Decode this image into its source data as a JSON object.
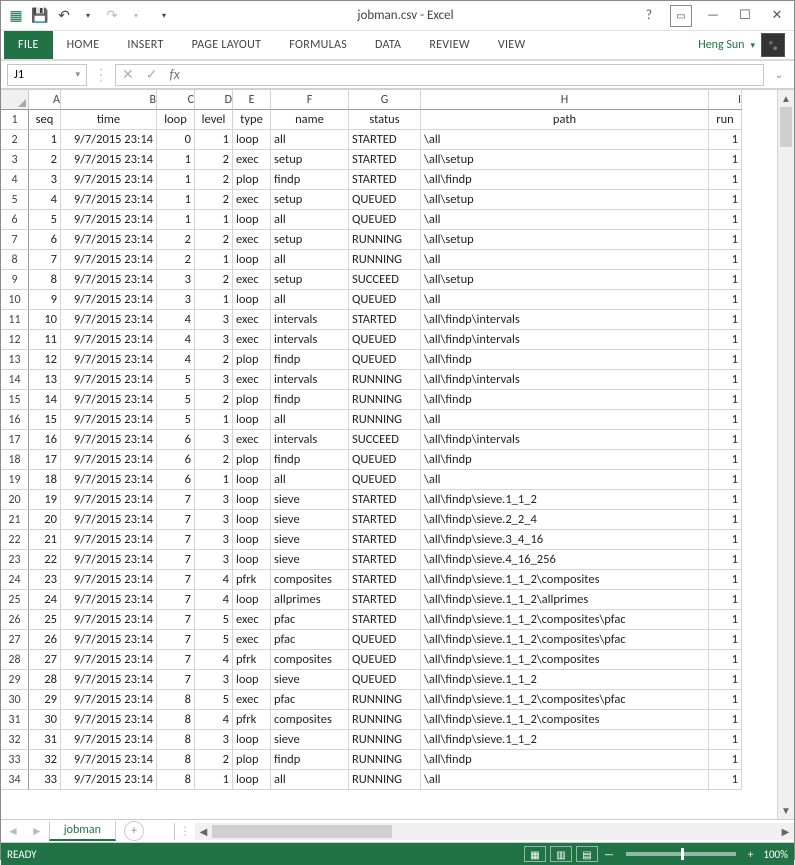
{
  "title": "jobman.csv - Excel",
  "user": "Heng Sun",
  "ribbon_tabs": [
    "FILE",
    "HOME",
    "INSERT",
    "PAGE LAYOUT",
    "FORMULAS",
    "DATA",
    "REVIEW",
    "VIEW"
  ],
  "namebox": "J1",
  "sheet_name": "jobman",
  "status": "READY",
  "zoom": "100%",
  "columns": [
    "A",
    "B",
    "C",
    "D",
    "E",
    "F",
    "G",
    "H",
    "I"
  ],
  "headers": {
    "A": "seq",
    "B": "time",
    "C": "loop",
    "D": "level",
    "E": "type",
    "F": "name",
    "G": "status",
    "H": "path",
    "I": "run"
  },
  "rows": [
    {
      "r": 2,
      "A": "1",
      "B": "9/7/2015 23:14",
      "C": "0",
      "D": "1",
      "E": "loop",
      "F": "all",
      "G": "STARTED",
      "H": "\\all",
      "I": "1"
    },
    {
      "r": 3,
      "A": "2",
      "B": "9/7/2015 23:14",
      "C": "1",
      "D": "2",
      "E": "exec",
      "F": "setup",
      "G": "STARTED",
      "H": "\\all\\setup",
      "I": "1"
    },
    {
      "r": 4,
      "A": "3",
      "B": "9/7/2015 23:14",
      "C": "1",
      "D": "2",
      "E": "plop",
      "F": "findp",
      "G": "STARTED",
      "H": "\\all\\findp",
      "I": "1"
    },
    {
      "r": 5,
      "A": "4",
      "B": "9/7/2015 23:14",
      "C": "1",
      "D": "2",
      "E": "exec",
      "F": "setup",
      "G": "QUEUED",
      "H": "\\all\\setup",
      "I": "1"
    },
    {
      "r": 6,
      "A": "5",
      "B": "9/7/2015 23:14",
      "C": "1",
      "D": "1",
      "E": "loop",
      "F": "all",
      "G": "QUEUED",
      "H": "\\all",
      "I": "1"
    },
    {
      "r": 7,
      "A": "6",
      "B": "9/7/2015 23:14",
      "C": "2",
      "D": "2",
      "E": "exec",
      "F": "setup",
      "G": "RUNNING",
      "H": "\\all\\setup",
      "I": "1"
    },
    {
      "r": 8,
      "A": "7",
      "B": "9/7/2015 23:14",
      "C": "2",
      "D": "1",
      "E": "loop",
      "F": "all",
      "G": "RUNNING",
      "H": "\\all",
      "I": "1"
    },
    {
      "r": 9,
      "A": "8",
      "B": "9/7/2015 23:14",
      "C": "3",
      "D": "2",
      "E": "exec",
      "F": "setup",
      "G": "SUCCEED",
      "H": "\\all\\setup",
      "I": "1"
    },
    {
      "r": 10,
      "A": "9",
      "B": "9/7/2015 23:14",
      "C": "3",
      "D": "1",
      "E": "loop",
      "F": "all",
      "G": "QUEUED",
      "H": "\\all",
      "I": "1"
    },
    {
      "r": 11,
      "A": "10",
      "B": "9/7/2015 23:14",
      "C": "4",
      "D": "3",
      "E": "exec",
      "F": "intervals",
      "G": "STARTED",
      "H": "\\all\\findp\\intervals",
      "I": "1"
    },
    {
      "r": 12,
      "A": "11",
      "B": "9/7/2015 23:14",
      "C": "4",
      "D": "3",
      "E": "exec",
      "F": "intervals",
      "G": "QUEUED",
      "H": "\\all\\findp\\intervals",
      "I": "1"
    },
    {
      "r": 13,
      "A": "12",
      "B": "9/7/2015 23:14",
      "C": "4",
      "D": "2",
      "E": "plop",
      "F": "findp",
      "G": "QUEUED",
      "H": "\\all\\findp",
      "I": "1"
    },
    {
      "r": 14,
      "A": "13",
      "B": "9/7/2015 23:14",
      "C": "5",
      "D": "3",
      "E": "exec",
      "F": "intervals",
      "G": "RUNNING",
      "H": "\\all\\findp\\intervals",
      "I": "1"
    },
    {
      "r": 15,
      "A": "14",
      "B": "9/7/2015 23:14",
      "C": "5",
      "D": "2",
      "E": "plop",
      "F": "findp",
      "G": "RUNNING",
      "H": "\\all\\findp",
      "I": "1"
    },
    {
      "r": 16,
      "A": "15",
      "B": "9/7/2015 23:14",
      "C": "5",
      "D": "1",
      "E": "loop",
      "F": "all",
      "G": "RUNNING",
      "H": "\\all",
      "I": "1"
    },
    {
      "r": 17,
      "A": "16",
      "B": "9/7/2015 23:14",
      "C": "6",
      "D": "3",
      "E": "exec",
      "F": "intervals",
      "G": "SUCCEED",
      "H": "\\all\\findp\\intervals",
      "I": "1"
    },
    {
      "r": 18,
      "A": "17",
      "B": "9/7/2015 23:14",
      "C": "6",
      "D": "2",
      "E": "plop",
      "F": "findp",
      "G": "QUEUED",
      "H": "\\all\\findp",
      "I": "1"
    },
    {
      "r": 19,
      "A": "18",
      "B": "9/7/2015 23:14",
      "C": "6",
      "D": "1",
      "E": "loop",
      "F": "all",
      "G": "QUEUED",
      "H": "\\all",
      "I": "1"
    },
    {
      "r": 20,
      "A": "19",
      "B": "9/7/2015 23:14",
      "C": "7",
      "D": "3",
      "E": "loop",
      "F": "sieve",
      "G": "STARTED",
      "H": "\\all\\findp\\sieve.1_1_2",
      "I": "1"
    },
    {
      "r": 21,
      "A": "20",
      "B": "9/7/2015 23:14",
      "C": "7",
      "D": "3",
      "E": "loop",
      "F": "sieve",
      "G": "STARTED",
      "H": "\\all\\findp\\sieve.2_2_4",
      "I": "1"
    },
    {
      "r": 22,
      "A": "21",
      "B": "9/7/2015 23:14",
      "C": "7",
      "D": "3",
      "E": "loop",
      "F": "sieve",
      "G": "STARTED",
      "H": "\\all\\findp\\sieve.3_4_16",
      "I": "1"
    },
    {
      "r": 23,
      "A": "22",
      "B": "9/7/2015 23:14",
      "C": "7",
      "D": "3",
      "E": "loop",
      "F": "sieve",
      "G": "STARTED",
      "H": "\\all\\findp\\sieve.4_16_256",
      "I": "1"
    },
    {
      "r": 24,
      "A": "23",
      "B": "9/7/2015 23:14",
      "C": "7",
      "D": "4",
      "E": "pfrk",
      "F": "composites",
      "G": "STARTED",
      "H": "\\all\\findp\\sieve.1_1_2\\composites",
      "I": "1"
    },
    {
      "r": 25,
      "A": "24",
      "B": "9/7/2015 23:14",
      "C": "7",
      "D": "4",
      "E": "loop",
      "F": "allprimes",
      "G": "STARTED",
      "H": "\\all\\findp\\sieve.1_1_2\\allprimes",
      "I": "1"
    },
    {
      "r": 26,
      "A": "25",
      "B": "9/7/2015 23:14",
      "C": "7",
      "D": "5",
      "E": "exec",
      "F": "pfac",
      "G": "STARTED",
      "H": "\\all\\findp\\sieve.1_1_2\\composites\\pfac",
      "I": "1"
    },
    {
      "r": 27,
      "A": "26",
      "B": "9/7/2015 23:14",
      "C": "7",
      "D": "5",
      "E": "exec",
      "F": "pfac",
      "G": "QUEUED",
      "H": "\\all\\findp\\sieve.1_1_2\\composites\\pfac",
      "I": "1"
    },
    {
      "r": 28,
      "A": "27",
      "B": "9/7/2015 23:14",
      "C": "7",
      "D": "4",
      "E": "pfrk",
      "F": "composites",
      "G": "QUEUED",
      "H": "\\all\\findp\\sieve.1_1_2\\composites",
      "I": "1"
    },
    {
      "r": 29,
      "A": "28",
      "B": "9/7/2015 23:14",
      "C": "7",
      "D": "3",
      "E": "loop",
      "F": "sieve",
      "G": "QUEUED",
      "H": "\\all\\findp\\sieve.1_1_2",
      "I": "1"
    },
    {
      "r": 30,
      "A": "29",
      "B": "9/7/2015 23:14",
      "C": "8",
      "D": "5",
      "E": "exec",
      "F": "pfac",
      "G": "RUNNING",
      "H": "\\all\\findp\\sieve.1_1_2\\composites\\pfac",
      "I": "1"
    },
    {
      "r": 31,
      "A": "30",
      "B": "9/7/2015 23:14",
      "C": "8",
      "D": "4",
      "E": "pfrk",
      "F": "composites",
      "G": "RUNNING",
      "H": "\\all\\findp\\sieve.1_1_2\\composites",
      "I": "1"
    },
    {
      "r": 32,
      "A": "31",
      "B": "9/7/2015 23:14",
      "C": "8",
      "D": "3",
      "E": "loop",
      "F": "sieve",
      "G": "RUNNING",
      "H": "\\all\\findp\\sieve.1_1_2",
      "I": "1"
    },
    {
      "r": 33,
      "A": "32",
      "B": "9/7/2015 23:14",
      "C": "8",
      "D": "2",
      "E": "plop",
      "F": "findp",
      "G": "RUNNING",
      "H": "\\all\\findp",
      "I": "1"
    },
    {
      "r": 34,
      "A": "33",
      "B": "9/7/2015 23:14",
      "C": "8",
      "D": "1",
      "E": "loop",
      "F": "all",
      "G": "RUNNING",
      "H": "\\all",
      "I": "1"
    }
  ]
}
